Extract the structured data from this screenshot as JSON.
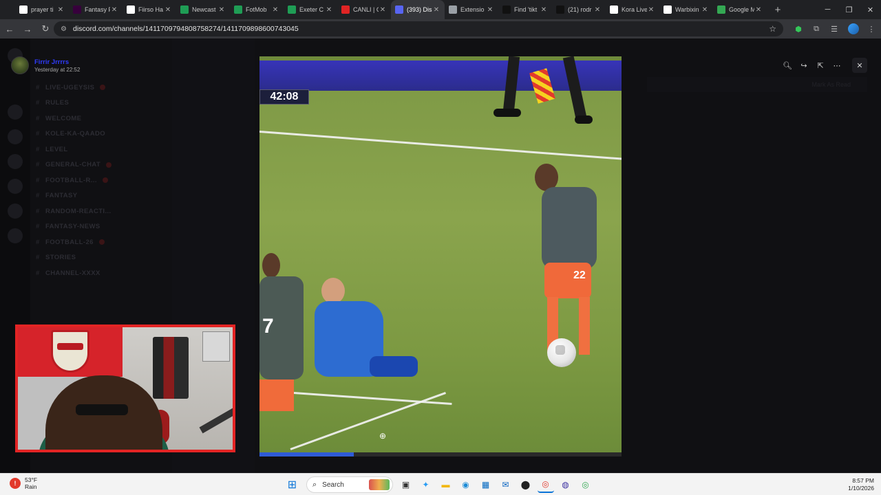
{
  "browser": {
    "tabs": [
      {
        "label": "prayer ti",
        "color": "#ffffff"
      },
      {
        "label": "Fantasy P",
        "color": "#37003c"
      },
      {
        "label": "Fiirso Ha",
        "color": "#ffffff"
      },
      {
        "label": "Newcast",
        "color": "#1f9d55"
      },
      {
        "label": "FotMob",
        "color": "#1f9d55"
      },
      {
        "label": "Exeter C",
        "color": "#1f9d55"
      },
      {
        "label": "CANLI | C",
        "color": "#e02424"
      },
      {
        "label": "(393) Dis",
        "color": "#5865f2"
      },
      {
        "label": "Extensio",
        "color": "#9aa0a6"
      },
      {
        "label": "Find 'tikt",
        "color": "#111111"
      },
      {
        "label": "(21) rodr",
        "color": "#111111"
      },
      {
        "label": "Kora Live",
        "color": "#ffffff"
      },
      {
        "label": "Warbixin",
        "color": "#ffffff"
      },
      {
        "label": "Google M",
        "color": "#34a853"
      }
    ],
    "active_tab_index": 7,
    "url": "discord.com/channels/1411709794808758274/1411709898600743045"
  },
  "discord": {
    "channels": [
      "LIVE-UGEYSIS",
      "RULES",
      "WELCOME",
      "KOLE-KA-QAADO",
      "LEVEL",
      "GENERAL-CHAT",
      "FOOTBALL-R...",
      "FANTASY",
      "RANDOM-REACTI...",
      "FANTASY-NEWS",
      "FOOTBALL-26",
      "STORIES",
      "CHANNEL-XXXX"
    ],
    "jump_label": "Mark As Read"
  },
  "viewer": {
    "poster_name": "Firrir Jrrrrs",
    "posted_time": "Yesterday at 22:52",
    "video_clock": "42:08",
    "progress": 0.26,
    "tools": {
      "zoom": "zoom-in-icon",
      "share": "share-arrow-icon",
      "open": "open-external-icon",
      "more": "ellipsis-icon",
      "close": "close-icon"
    }
  },
  "taskbar": {
    "weather_temp": "53°F",
    "weather_desc": "Rain",
    "weather_badge": "!",
    "search_label": "Search",
    "time": "8:57 PM",
    "date": "1/10/2026"
  },
  "colors": {
    "accent_discord": "#5865f2",
    "webcam_border": "#e32424",
    "progress_fill": "#2f5bd6"
  }
}
